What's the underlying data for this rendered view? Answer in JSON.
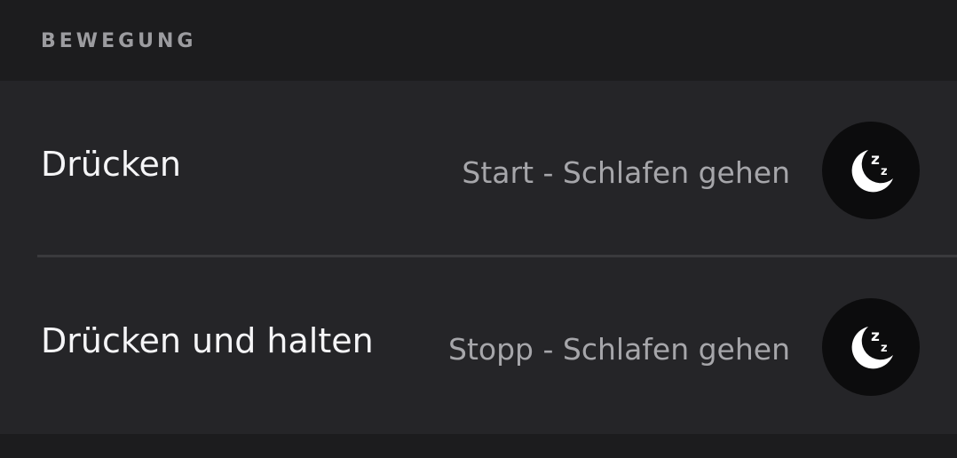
{
  "section": {
    "title": "BEWEGUNG"
  },
  "rows": [
    {
      "label": "Drücken",
      "value": "Start - Schlafen gehen",
      "icon": "sleep-moon-icon"
    },
    {
      "label": "Drücken und halten",
      "value": "Stopp - Schlafen gehen",
      "icon": "sleep-moon-icon"
    }
  ],
  "colors": {
    "background": "#1c1c1e",
    "card": "#252528",
    "button": "#0c0c0d",
    "title_text": "#f5f5f7",
    "value_text": "#a6a6aa",
    "header_text": "#9c9ca0"
  }
}
